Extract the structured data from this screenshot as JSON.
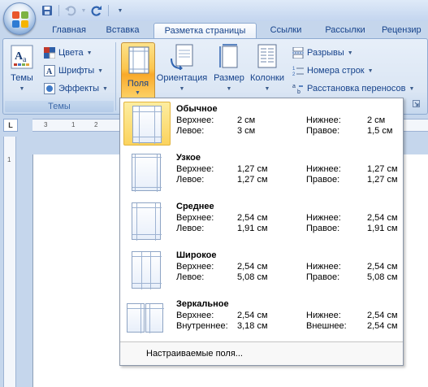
{
  "qat": {
    "save_icon": "save-icon",
    "undo_icon": "undo-icon",
    "redo_icon": "redo-icon"
  },
  "tabs": [
    "Главная",
    "Вставка",
    "Разметка страницы",
    "Ссылки",
    "Рассылки",
    "Рецензир"
  ],
  "active_tab": "Разметка страницы",
  "ribbon": {
    "themes_group": {
      "label": "Темы",
      "themes_button": "Темы",
      "colors_button": "Цвета",
      "fonts_button": "Шрифты",
      "effects_button": "Эффекты"
    },
    "page_setup_group": {
      "margins_button": "Поля",
      "orientation_button": "Ориентация",
      "size_button": "Размер",
      "columns_button": "Колонки",
      "breaks_button": "Разрывы",
      "line_numbers_button": "Номера строк",
      "hyphenation_button": "Расстановка переносов"
    }
  },
  "ruler": {
    "corner_symbol": "L",
    "marks": [
      "3",
      "1",
      "2",
      "1"
    ]
  },
  "margins_menu": {
    "presets": [
      {
        "name": "Обычное",
        "top_label": "Верхнее:",
        "top": "2 см",
        "bottom_label": "Нижнее:",
        "bottom": "2 см",
        "left_label": "Левое:",
        "left": "3 см",
        "right_label": "Правое:",
        "right": "1,5 см",
        "selected": true
      },
      {
        "name": "Узкое",
        "top_label": "Верхнее:",
        "top": "1,27 см",
        "bottom_label": "Нижнее:",
        "bottom": "1,27 см",
        "left_label": "Левое:",
        "left": "1,27 см",
        "right_label": "Правое:",
        "right": "1,27 см",
        "selected": false
      },
      {
        "name": "Среднее",
        "top_label": "Верхнее:",
        "top": "2,54 см",
        "bottom_label": "Нижнее:",
        "bottom": "2,54 см",
        "left_label": "Левое:",
        "left": "1,91 см",
        "right_label": "Правое:",
        "right": "1,91 см",
        "selected": false
      },
      {
        "name": "Широкое",
        "top_label": "Верхнее:",
        "top": "2,54 см",
        "bottom_label": "Нижнее:",
        "bottom": "2,54 см",
        "left_label": "Левое:",
        "left": "5,08 см",
        "right_label": "Правое:",
        "right": "5,08 см",
        "selected": false
      },
      {
        "name": "Зеркальное",
        "top_label": "Верхнее:",
        "top": "2,54 см",
        "bottom_label": "Нижнее:",
        "bottom": "2,54 см",
        "left_label": "Внутреннее:",
        "left": "3,18 см",
        "right_label": "Внешнее:",
        "right": "2,54 см",
        "selected": false
      }
    ],
    "custom_margins": "Настраиваемые поля..."
  }
}
